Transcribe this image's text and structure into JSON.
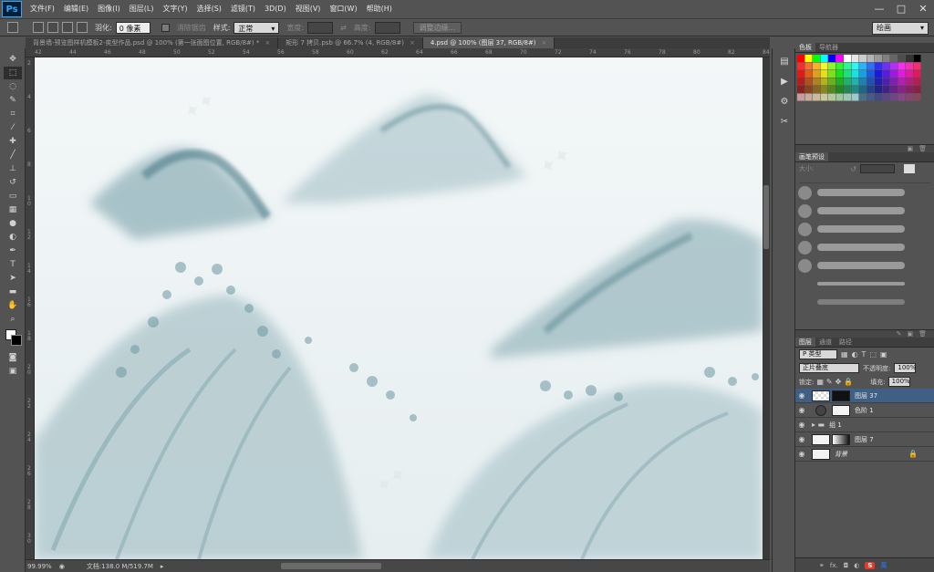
{
  "app": {
    "logo": "Ps"
  },
  "menu": [
    "文件(F)",
    "编辑(E)",
    "图像(I)",
    "图层(L)",
    "文字(Y)",
    "选择(S)",
    "滤镜(T)",
    "3D(D)",
    "视图(V)",
    "窗口(W)",
    "帮助(H)"
  ],
  "window_controls": {
    "minimize": "—",
    "maximize": "□",
    "close": "✕"
  },
  "options": {
    "feather_label": "羽化:",
    "feather_value": "0 像素",
    "antialias_label": "消除锯齿",
    "style_label": "样式:",
    "style_value": "正常",
    "width_label": "宽度:",
    "height_label": "高度:",
    "refine_edge": "调整边缘...",
    "workspace": "绘画"
  },
  "tabs": [
    {
      "label": "背景墙-预览图样机模板2-奕型作品.psd @ 100% (第一张面图位置, RGB/8#) *"
    },
    {
      "label": "矩形 7 拷贝.psb @ 66.7% (4, RGB/8#)"
    },
    {
      "label": "4.psd @ 100% (图层 37, RGB/8#)"
    }
  ],
  "ruler_top": [
    "42",
    "44",
    "46",
    "48",
    "50",
    "52",
    "54",
    "56",
    "58",
    "60",
    "62",
    "64",
    "66",
    "68",
    "70",
    "72",
    "74",
    "76",
    "78",
    "80",
    "82",
    "84"
  ],
  "ruler_left": [
    "2",
    "4",
    "6",
    "8",
    "1\n0",
    "1\n2",
    "1\n4",
    "1\n6",
    "1\n8",
    "2\n0",
    "2\n2",
    "2\n4",
    "2\n6",
    "2\n8",
    "3\n0"
  ],
  "status": {
    "zoom": "99.99%",
    "doc": "文档:138.0 M/519.7M"
  },
  "panels": {
    "swatches_tabs": [
      "色板",
      "导航器"
    ],
    "brush_tab": "画笔预设",
    "brush_size_label": "大小:",
    "layers_tabs": [
      "图层",
      "通道",
      "路径"
    ],
    "filter_kind": "P 类型",
    "blend_mode": "正片叠底",
    "opacity_label": "不透明度:",
    "opacity_value": "100%",
    "lock_label": "锁定:",
    "fill_label": "填充:",
    "fill_value": "100%",
    "layers": [
      {
        "name": "图层 37",
        "selected": true
      },
      {
        "name": "色阶 1",
        "selected": false
      },
      {
        "name": "组 1",
        "selected": false
      },
      {
        "name": "图层 7",
        "selected": false
      },
      {
        "name": "背景",
        "selected": false
      }
    ]
  },
  "ime": {
    "label": "英"
  }
}
